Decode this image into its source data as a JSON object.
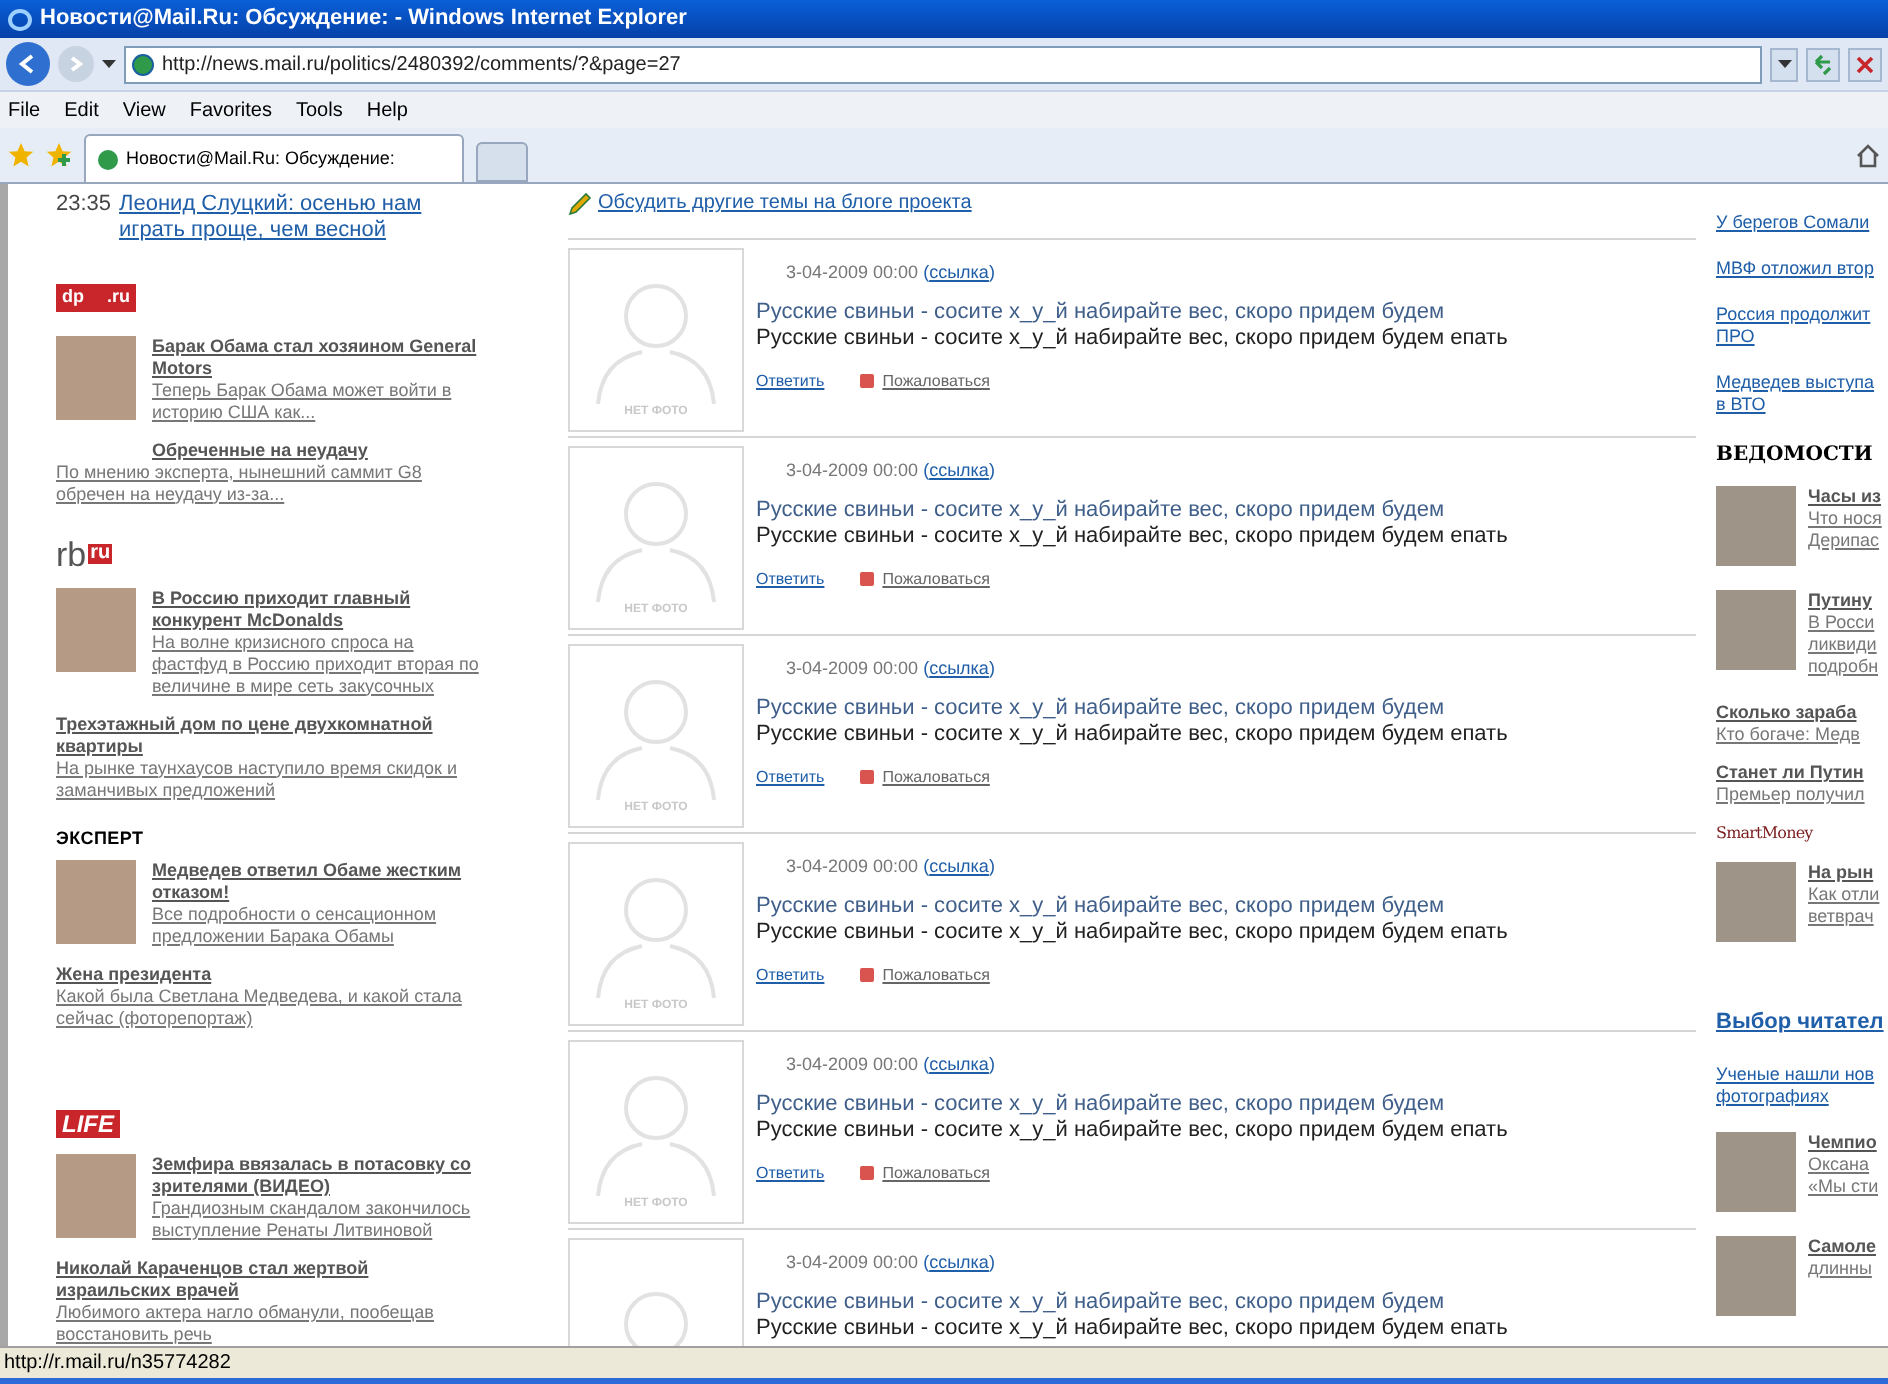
{
  "window": {
    "title": "Новости@Mail.Ru: Обсуждение: - Windows Internet Explorer"
  },
  "address_bar": {
    "url": "http://news.mail.ru/politics/2480392/comments/?&page=27"
  },
  "menu": [
    "File",
    "Edit",
    "View",
    "Favorites",
    "Tools",
    "Help"
  ],
  "tabs": [
    {
      "label": "Новости@Mail.Ru: Обсуждение:",
      "selected": true
    }
  ],
  "left_column": [
    {
      "kind": "time_link",
      "time": "23:35",
      "link": "Леонид Слуцкий: осенью нам играть проще, чем весной"
    },
    {
      "kind": "logo",
      "parts": [
        "dp",
        ".ru"
      ]
    },
    {
      "kind": "photo_story",
      "title": "Барак Обама стал хозяином General Motors",
      "lead": "Теперь Барак Обама может войти в историю США как..."
    },
    {
      "kind": "indent_story",
      "title": "Обреченные на неудачу",
      "lead": "По мнению эксперта, нынешний саммит G8 обречен на неудачу из-за..."
    },
    {
      "kind": "logo",
      "parts": [
        "rb",
        "ru"
      ]
    },
    {
      "kind": "photo_story",
      "title": "В Россию приходит главный конкурент McDonalds",
      "lead": "На волне кризисного спроса на фастфуд в Россию приходит вторая по величине в мире сеть закусочных"
    },
    {
      "kind": "story",
      "title": "Трехэтажный дом по цене двухкомнатной квартиры",
      "lead": "На рынке таунхаусов наступило время скидок и заманчивых предложений"
    },
    {
      "kind": "logo",
      "parts": [
        "ЭКСПЕРТ"
      ]
    },
    {
      "kind": "photo_story",
      "title": "Медведев ответил Обаме жестким отказом!",
      "lead": "Все подробности о сенсационном предложении Барака Обамы"
    },
    {
      "kind": "story",
      "title": "Жена президента",
      "lead": "Какой была Светлана Медведева, и какой стала сейчас (фоторепортаж)"
    },
    {
      "kind": "logo",
      "parts": [
        "LIFE"
      ]
    },
    {
      "kind": "photo_story",
      "title": "Земфира ввязалась в потасовку со зрителями (ВИДЕО)",
      "lead": "Грандиозным скандалом закончилось выступление Ренаты Литвиновой"
    },
    {
      "kind": "story",
      "title": "Николай Караченцов стал жертвой израильских врачей",
      "lead": "Любимого актера нагло обманули, пообещав восстановить речь"
    }
  ],
  "blog_link": "Обсудить другие темы на блоге проекта",
  "comments": [
    {
      "no_photo": "НЕТ ФОТО",
      "date": "3-04-2009 00:00",
      "link": "(ссылка)",
      "lines": [
        "Русские свиньи - сосите х_у_й набирайте вес, скоро придем будем",
        "Русские свиньи - сосите х_у_й набирайте вес, скоро придем будем епать"
      ],
      "reply": "Ответить",
      "complain": "Пожаловаться"
    },
    {
      "no_photo": "НЕТ ФОТО",
      "date": "3-04-2009 00:00",
      "link": "(ссылка)",
      "lines": [
        "Русские свиньи - сосите х_у_й набирайте вес, скоро придем будем",
        "Русские свиньи - сосите х_у_й набирайте вес, скоро придем будем епать"
      ],
      "reply": "Ответить",
      "complain": "Пожаловаться"
    },
    {
      "no_photo": "НЕТ ФОТО",
      "date": "3-04-2009 00:00",
      "link": "(ссылка)",
      "lines": [
        "Русские свиньи - сосите х_у_й набирайте вес, скоро придем будем",
        "Русские свиньи - сосите х_у_й набирайте вес, скоро придем будем епать"
      ],
      "reply": "Ответить",
      "complain": "Пожаловаться"
    },
    {
      "no_photo": "НЕТ ФОТО",
      "date": "3-04-2009 00:00",
      "link": "(ссылка)",
      "lines": [
        "Русские свиньи - сосите х_у_й набирайте вес, скоро придем будем",
        "Русские свиньи - сосите х_у_й набирайте вес, скоро придем будем епать"
      ],
      "reply": "Ответить",
      "complain": "Пожаловаться"
    },
    {
      "no_photo": "НЕТ ФОТО",
      "date": "3-04-2009 00:00",
      "link": "(ссылка)",
      "lines": [
        "Русские свиньи - сосите х_у_й набирайте вес, скоро придем будем",
        "Русские свиньи - сосите х_у_й набирайте вес, скоро придем будем епать"
      ],
      "reply": "Ответить",
      "complain": "Пожаловаться"
    },
    {
      "date": "3-04-2009 00:00",
      "link": "(ссылка)",
      "lines": [
        "Русские свиньи - сосите х_у_й набирайте вес, скоро придем будем",
        "Русские свиньи - сосите х_у_й набирайте вес, скоро придем будем епать"
      ]
    }
  ],
  "right_column": [
    {
      "kind": "link",
      "lines": [
        "У берегов Сомали"
      ]
    },
    {
      "kind": "link",
      "lines": [
        "МВФ отложил втор"
      ]
    },
    {
      "kind": "link",
      "lines": [
        "Россия продолжит",
        "ПРО"
      ]
    },
    {
      "kind": "link",
      "lines": [
        "Медведев выступа",
        "в ВТО"
      ]
    },
    {
      "kind": "logo",
      "text": "ВЕДОМОСТИ"
    },
    {
      "kind": "photo_story",
      "title": "Часы из",
      "lead": [
        "Что нося",
        "Дерипас"
      ]
    },
    {
      "kind": "photo_story",
      "title": "Путину",
      "lead": [
        "В Росси",
        "ликвиди",
        "подробн"
      ]
    },
    {
      "kind": "story",
      "title": "Сколько зараба",
      "lead": [
        "Кто богаче: Медв"
      ]
    },
    {
      "kind": "story",
      "title": "Станет ли Путин",
      "lead": [
        "Премьер получил"
      ]
    },
    {
      "kind": "logo",
      "text": "SmartMoney"
    },
    {
      "kind": "photo_story",
      "title": "На рын",
      "lead": [
        "Как отли",
        "ветврач"
      ]
    },
    {
      "kind": "heading",
      "text": "Выбор читател"
    },
    {
      "kind": "link",
      "lines": [
        "Ученые нашли нов",
        "фотографиях"
      ]
    },
    {
      "kind": "photo_story",
      "title": "Чемпио",
      "lead": [
        "Оксана",
        "«Мы сти"
      ]
    },
    {
      "kind": "photo_story",
      "title": "Самоле",
      "lead": [
        "длинны"
      ]
    }
  ],
  "status_bar": {
    "text": "http://r.mail.ru/n35774282"
  }
}
